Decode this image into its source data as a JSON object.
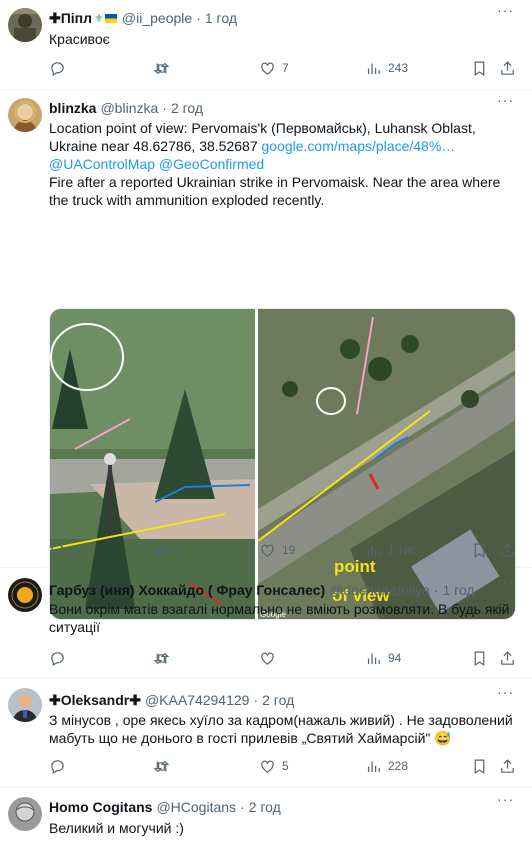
{
  "tweets": [
    {
      "name": "✚Піпл",
      "name_extra": "⚜",
      "handle": "@ii_people",
      "time": "1 год",
      "text": "Красивоє",
      "counts": {
        "reply": "",
        "retweet": "",
        "like": "7",
        "views": "243"
      }
    },
    {
      "name": "blinzka",
      "handle": "@blinzka",
      "time": "2 год",
      "text_parts": {
        "p1": "Location point of view: Pervomais'k (Первомайськ), Luhansk Oblast, Ukraine near 48.62786, 38.52687 ",
        "link1": "google.com/maps/place/48%…",
        "link2": "@UAControlMap",
        "link3": "@GeoConfirmed",
        "p2": "Fire after a reported Ukrainian strike in Pervomaisk. Near the area where the truck with ammunition exploded recently."
      },
      "media": {
        "overlay_text_1": "point",
        "overlay_text_2": "of view",
        "watermark": "Google"
      },
      "counts": {
        "reply": "2",
        "retweet": "4",
        "like": "19",
        "views": "1 тис."
      }
    },
    {
      "name": "Гарбуз (иня) Хоккайдо ( Фрау Гонсалес)",
      "handle": "@dochanatoliya",
      "time": "1 год",
      "text": "Вони окрім матів взагалі  нормально  не вміють розмовляти. В будь якій ситуації",
      "counts": {
        "reply": "",
        "retweet": "",
        "like": "",
        "views": "94"
      }
    },
    {
      "name": "✚Oleksandr✚",
      "handle": "@KAA74294129",
      "time": "2 год",
      "text": "З мінусов , оре якесь хуїло за кадром(нажаль живий) . Не задоволений мабуть що не донього в гості прилевів „Святий Хаймарсій\" 😅",
      "counts": {
        "reply": "",
        "retweet": "",
        "like": "5",
        "views": "228"
      }
    },
    {
      "name": "Homo Cogitans",
      "handle": "@HCogitans",
      "time": "2 год",
      "text": "Великий и могучий :)"
    }
  ],
  "colors": {
    "accent": "#1d9bf0",
    "secondary_text": "#536471",
    "border": "#eff3f4",
    "marker_yellow": "#f3e31a"
  },
  "icons": [
    "reply-icon",
    "retweet-icon",
    "like-icon",
    "views-icon",
    "bookmark-icon",
    "share-icon",
    "more-icon"
  ]
}
